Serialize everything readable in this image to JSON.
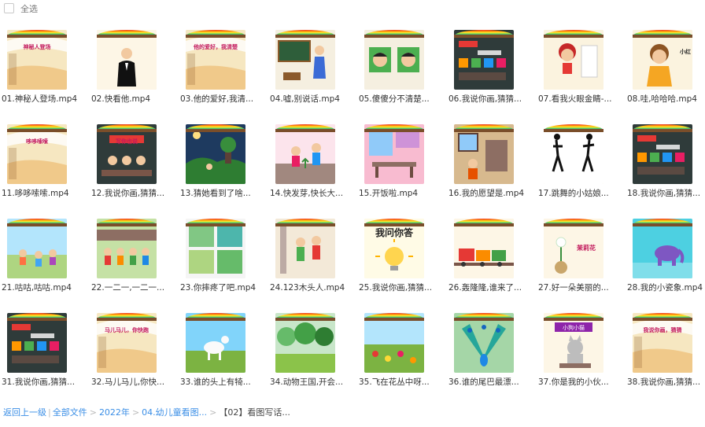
{
  "header": {
    "select_all": "全选"
  },
  "files": [
    {
      "name": "01.神秘人登场.mp4",
      "thumb": "scroll",
      "banner": "神秘人登场"
    },
    {
      "name": "02.快看他.mp4",
      "thumb": "tuxedo"
    },
    {
      "name": "03.他的爱好,我清...",
      "thumb": "scroll",
      "banner": "他的爱好，我清楚"
    },
    {
      "name": "04.嘘,别说话.mp4",
      "thumb": "teacher"
    },
    {
      "name": "05.傻傻分不清楚...",
      "thumb": "faces"
    },
    {
      "name": "06.我说你画,猜猜...",
      "thumb": "chalkboard"
    },
    {
      "name": "07.看我火眼金睛-...",
      "thumb": "girlred"
    },
    {
      "name": "08.哇,哈哈哈.mp4",
      "thumb": "girlbun",
      "banner": "小红"
    },
    {
      "name": "11.哆哆嗦嗦.mp4",
      "thumb": "scroll",
      "banner": "哆哆嗦嗦"
    },
    {
      "name": "12.我说你画,猜猜...",
      "thumb": "chalkboard2",
      "banner": "写你也说"
    },
    {
      "name": "13.猜她看到了啥...",
      "thumb": "night"
    },
    {
      "name": "14.快发芽,快长大...",
      "thumb": "garden"
    },
    {
      "name": "15.开饭啦.mp4",
      "thumb": "dining"
    },
    {
      "name": "16.我的愿望是.mp4",
      "thumb": "room"
    },
    {
      "name": "17.跳舞的小姑娘...",
      "thumb": "dancers"
    },
    {
      "name": "18.我说你画,猜猜...",
      "thumb": "chalkboard"
    },
    {
      "name": "21.咕咕,咕咕.mp4",
      "thumb": "outdoor"
    },
    {
      "name": "22.一二一,一二一...",
      "thumb": "march"
    },
    {
      "name": "23.你摔疼了吧.mp4",
      "thumb": "panels"
    },
    {
      "name": "24.123木头人.mp4",
      "thumb": "kids"
    },
    {
      "name": "25.我说你画,猜猜...",
      "thumb": "bulb",
      "banner": "我问你答"
    },
    {
      "name": "26.轰隆隆,谁来了...",
      "thumb": "train"
    },
    {
      "name": "27.好一朵美丽的...",
      "thumb": "jasmine",
      "banner": "茉莉花"
    },
    {
      "name": "28.我的小瓷象.mp4",
      "thumb": "elephant"
    },
    {
      "name": "31.我说你画,猜猜...",
      "thumb": "chalkboard"
    },
    {
      "name": "32.马儿马儿,你快...",
      "thumb": "scroll",
      "banner": "马儿马儿，你快跑"
    },
    {
      "name": "33.谁的头上有犄...",
      "thumb": "goat"
    },
    {
      "name": "34.动物王国,开会...",
      "thumb": "forest"
    },
    {
      "name": "35.飞在花丛中呀...",
      "thumb": "flowers"
    },
    {
      "name": "36.谁的尾巴最漂...",
      "thumb": "peacock"
    },
    {
      "name": "37.你是我的小伙...",
      "thumb": "cat",
      "banner": "小狗小猫"
    },
    {
      "name": "38.我说你画,猜猜...",
      "thumb": "scroll",
      "banner": "我说你画，猜猜"
    }
  ],
  "breadcrumb": {
    "back": "返回上一级",
    "all_files": "全部文件",
    "year": "2022年",
    "folder": "04.幼儿童看图...",
    "current": "【02】看图写话..."
  },
  "colors": {
    "link": "#3a8ee6",
    "text": "#333333"
  }
}
